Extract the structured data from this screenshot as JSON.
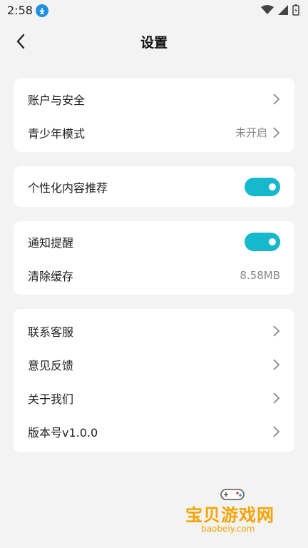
{
  "status_bar": {
    "time": "2:58"
  },
  "header": {
    "title": "设置"
  },
  "sections": [
    {
      "rows": [
        {
          "label": "账户与安全",
          "value": ""
        },
        {
          "label": "青少年模式",
          "value": "未开启"
        }
      ]
    },
    {
      "rows": [
        {
          "label": "个性化内容推荐",
          "toggle": true
        }
      ]
    },
    {
      "rows": [
        {
          "label": "通知提醒",
          "toggle": true
        },
        {
          "label": "清除缓存",
          "value": "8.58MB"
        }
      ]
    },
    {
      "rows": [
        {
          "label": "联系客服"
        },
        {
          "label": "意见反馈"
        },
        {
          "label": "关于我们"
        },
        {
          "label": "版本号v1.0.0"
        }
      ]
    }
  ],
  "watermark": {
    "text": "宝贝游戏网",
    "url": "baobeiy.com"
  },
  "colors": {
    "accent": "#16b8cc",
    "background": "#f3f3f3",
    "card": "#ffffff"
  },
  "icons": [
    "download-icon",
    "wifi-icon",
    "signal-icon",
    "battery-icon",
    "back-arrow-icon",
    "chevron-right-icon",
    "gamepad-icon"
  ]
}
